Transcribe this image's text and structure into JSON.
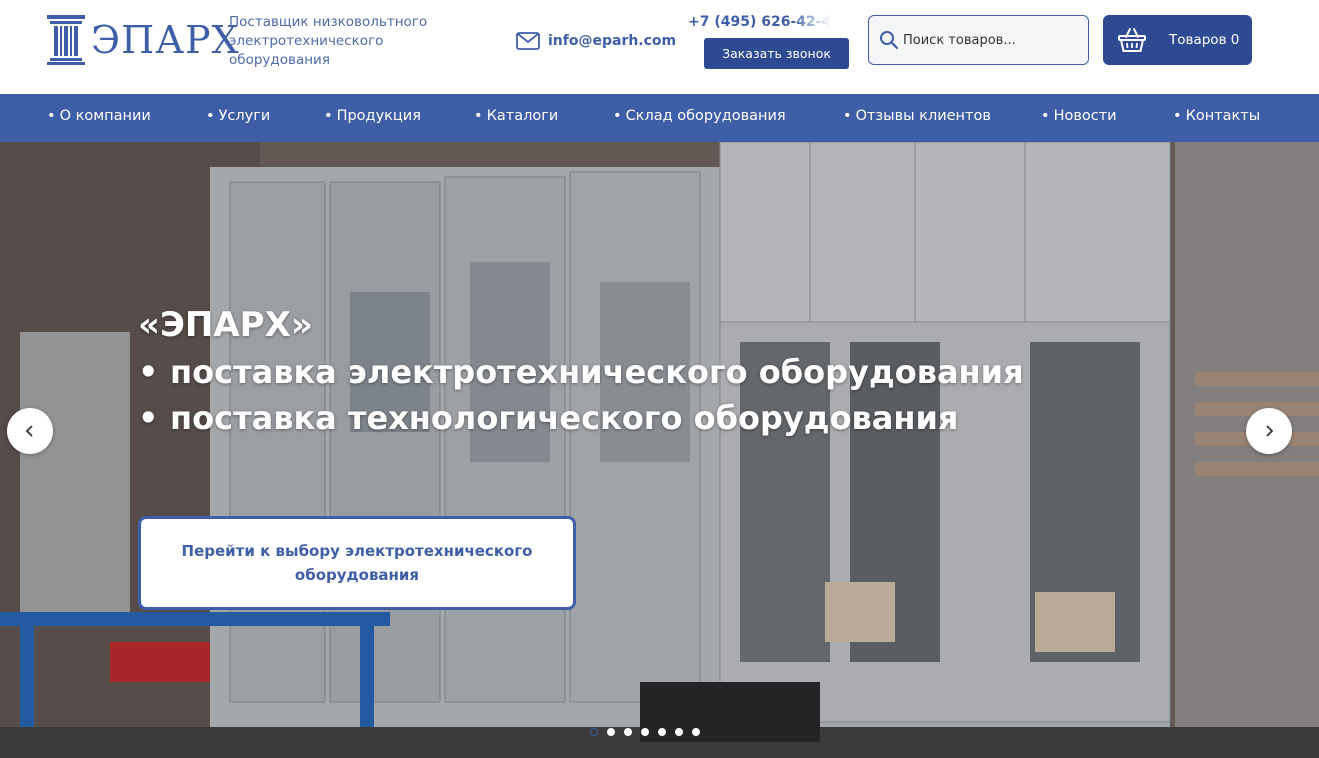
{
  "header": {
    "logo_text": "ЭПАРХ",
    "tagline": "Поставщик низковольтного электротехнического оборудования",
    "email": "info@eparh.com",
    "phone": "+7 (495) 626-42-4",
    "callback_label": "Заказать звонок",
    "search_placeholder": "Поиск товаров...",
    "cart_label": "Товаров 0"
  },
  "nav": {
    "items": [
      {
        "label": "О компании"
      },
      {
        "label": "Услуги"
      },
      {
        "label": "Продукция"
      },
      {
        "label": "Каталоги"
      },
      {
        "label": "Склад оборудования"
      },
      {
        "label": "Отзывы клиентов"
      },
      {
        "label": "Новости"
      },
      {
        "label": "Контакты"
      }
    ]
  },
  "hero": {
    "title": "«ЭПАРХ»",
    "lines": [
      "поставка электротехнического оборудования",
      "поставка технологического оборудования"
    ],
    "bullet": "•",
    "cta_label": "Перейти к выбору электротехнического оборудования",
    "slide_count": 7,
    "active_slide": 1
  },
  "icons": {
    "logo": "column-logo-icon",
    "email": "envelope-icon",
    "phone": "phone-icon",
    "search": "search-icon",
    "cart": "basket-icon",
    "prev": "chevron-left-icon",
    "next": "chevron-right-icon"
  },
  "colors": {
    "brand": "#3f5ea8",
    "brand_dark": "#2e4a92",
    "nav_bg": "#3f5ea8"
  }
}
